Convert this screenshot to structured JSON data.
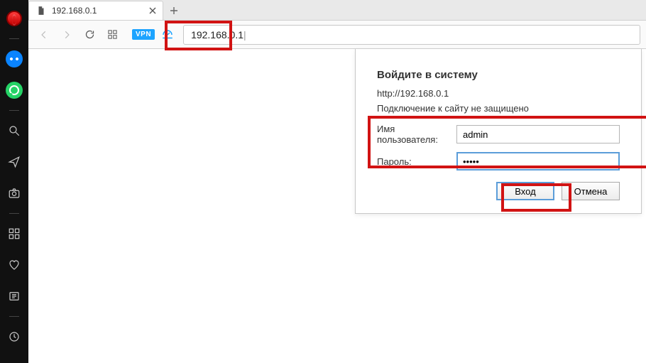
{
  "tab": {
    "title": "192.168.0.1"
  },
  "toolbar": {
    "vpn_label": "VPN"
  },
  "url": {
    "text": "192.168.0.1"
  },
  "dialog": {
    "title": "Войдите в систему",
    "host": "http://192.168.0.1",
    "warning": "Подключение к сайту не защищено",
    "username_label": "Имя пользователя:",
    "username_value": "admin",
    "password_label": "Пароль:",
    "password_value": "•••••",
    "submit_label": "Вход",
    "cancel_label": "Отмена"
  }
}
